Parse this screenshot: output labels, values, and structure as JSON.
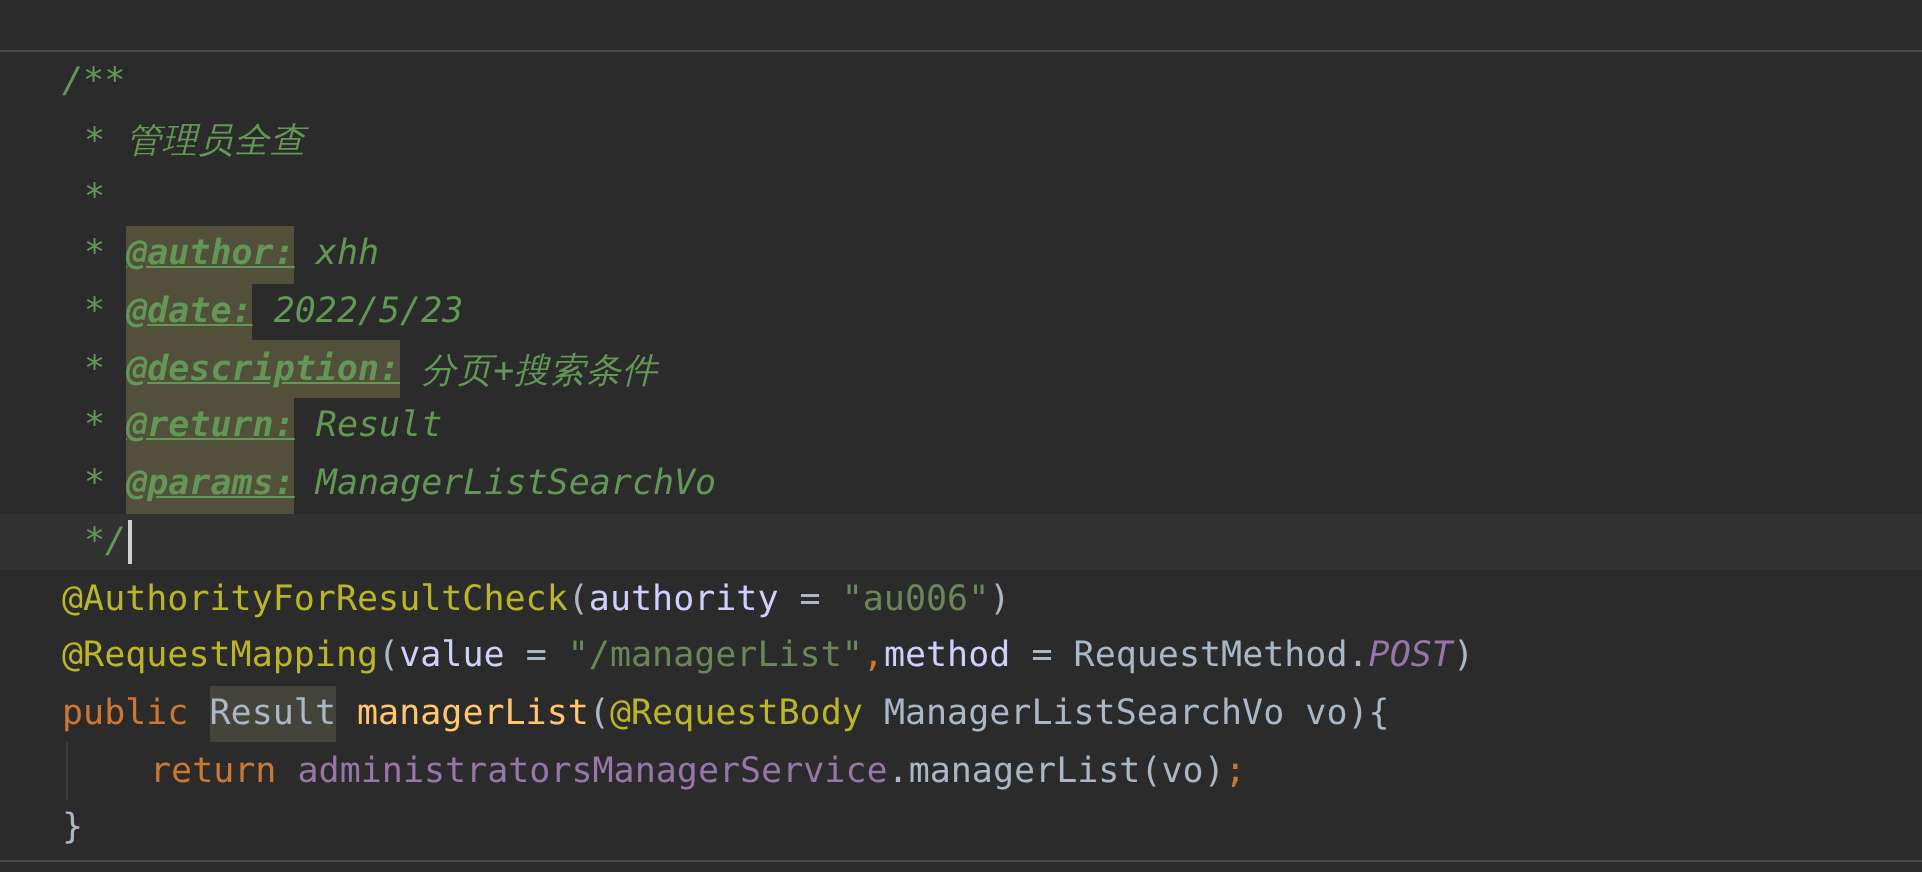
{
  "editor": {
    "lines": [
      {
        "kind": "code",
        "current": false,
        "tokens": [
          {
            "text": "/**",
            "kind": "comment"
          }
        ]
      },
      {
        "kind": "doc",
        "current": false,
        "tokens": [
          {
            "text": "* 管理员全查",
            "kind": "comment"
          }
        ]
      },
      {
        "kind": "doc",
        "current": false,
        "tokens": [
          {
            "text": "*",
            "kind": "comment"
          }
        ]
      },
      {
        "kind": "doc",
        "current": false,
        "tokens": [
          {
            "text": "* ",
            "kind": "comment"
          },
          {
            "text": "@author:",
            "kind": "tag"
          },
          {
            "text": " xhh",
            "kind": "comment"
          }
        ]
      },
      {
        "kind": "doc",
        "current": false,
        "tokens": [
          {
            "text": "* ",
            "kind": "comment"
          },
          {
            "text": "@date:",
            "kind": "tag"
          },
          {
            "text": " 2022/5/23",
            "kind": "comment"
          }
        ]
      },
      {
        "kind": "doc",
        "current": false,
        "tokens": [
          {
            "text": "* ",
            "kind": "comment"
          },
          {
            "text": "@description:",
            "kind": "tag"
          },
          {
            "text": " 分页+搜索条件",
            "kind": "comment"
          }
        ]
      },
      {
        "kind": "doc",
        "current": false,
        "tokens": [
          {
            "text": "* ",
            "kind": "comment"
          },
          {
            "text": "@return:",
            "kind": "tag"
          },
          {
            "text": " Result",
            "kind": "comment"
          }
        ]
      },
      {
        "kind": "doc",
        "current": false,
        "tokens": [
          {
            "text": "* ",
            "kind": "comment"
          },
          {
            "text": "@params:",
            "kind": "tag"
          },
          {
            "text": " ManagerListSearchVo",
            "kind": "comment"
          }
        ]
      },
      {
        "kind": "doc",
        "current": true,
        "tokens": [
          {
            "text": "*/",
            "kind": "comment"
          }
        ]
      },
      {
        "kind": "code",
        "current": false,
        "tokens": [
          {
            "text": "@AuthorityForResultCheck",
            "kind": "annotation"
          },
          {
            "text": "(",
            "kind": "plain"
          },
          {
            "text": "authority",
            "kind": "param"
          },
          {
            "text": " = ",
            "kind": "plain"
          },
          {
            "text": "\"au006\"",
            "kind": "string"
          },
          {
            "text": ")",
            "kind": "plain"
          }
        ]
      },
      {
        "kind": "code",
        "current": false,
        "tokens": [
          {
            "text": "@RequestMapping",
            "kind": "annotation"
          },
          {
            "text": "(",
            "kind": "plain"
          },
          {
            "text": "value",
            "kind": "param"
          },
          {
            "text": " = ",
            "kind": "plain"
          },
          {
            "text": "\"/managerList\"",
            "kind": "string"
          },
          {
            "text": ",",
            "kind": "keyword"
          },
          {
            "text": "method",
            "kind": "param"
          },
          {
            "text": " = RequestMethod.",
            "kind": "plain"
          },
          {
            "text": "POST",
            "kind": "constant"
          },
          {
            "text": ")",
            "kind": "plain"
          }
        ]
      },
      {
        "kind": "code",
        "current": false,
        "tokens": [
          {
            "text": "public ",
            "kind": "keyword"
          },
          {
            "text": "Result",
            "kind": "usage"
          },
          {
            "text": " managerList",
            "kind": "method"
          },
          {
            "text": "(",
            "kind": "plain"
          },
          {
            "text": "@RequestBody",
            "kind": "annotation"
          },
          {
            "text": " ManagerListSearchVo vo){",
            "kind": "plain"
          }
        ]
      },
      {
        "kind": "body",
        "current": false,
        "tokens": [
          {
            "text": "return ",
            "kind": "keyword"
          },
          {
            "text": "administratorsManagerService",
            "kind": "field"
          },
          {
            "text": ".managerList(vo)",
            "kind": "plain"
          },
          {
            "text": ";",
            "kind": "keyword"
          }
        ]
      },
      {
        "kind": "code",
        "current": false,
        "tokens": [
          {
            "text": "}",
            "kind": "plain"
          }
        ]
      }
    ]
  }
}
